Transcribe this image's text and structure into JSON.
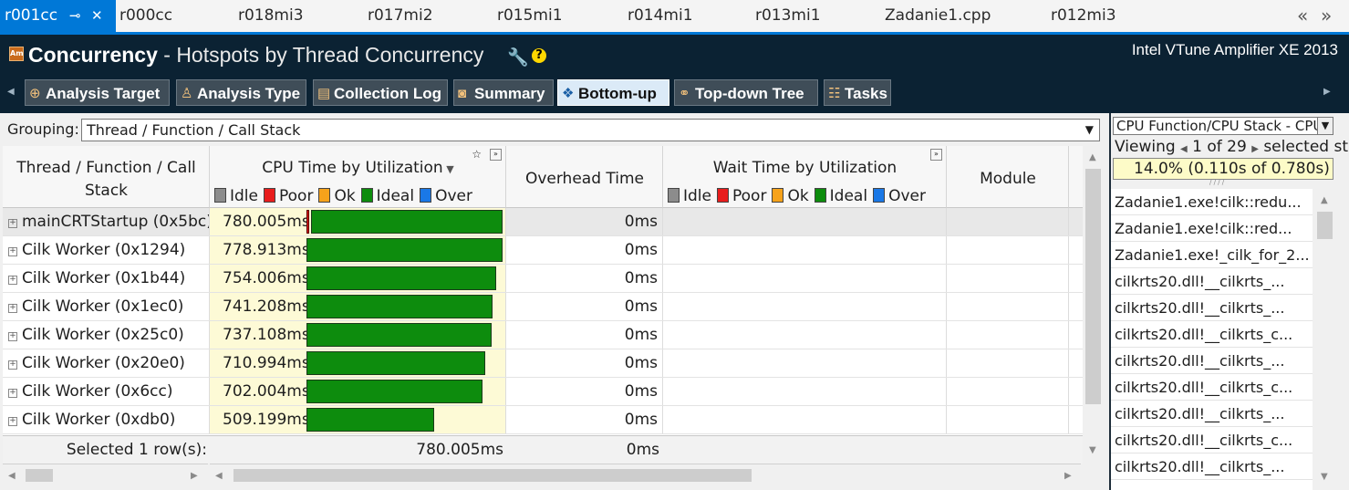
{
  "doc_tabs": [
    {
      "label": "r001cc",
      "active": true
    },
    {
      "label": "r000cc"
    },
    {
      "label": "r018mi3"
    },
    {
      "label": "r017mi2"
    },
    {
      "label": "r015mi1"
    },
    {
      "label": "r014mi1"
    },
    {
      "label": "r013mi1"
    },
    {
      "label": "Zadanie1.cpp"
    },
    {
      "label": "r012mi3"
    }
  ],
  "icons": {
    "pin": "pin-icon",
    "close": "close-icon",
    "scroll_left": "double-chevron-left-icon",
    "scroll_right": "double-chevron-right-icon",
    "wrench": "wrench-icon",
    "help": "help-icon"
  },
  "header": {
    "title_bold": "Concurrency",
    "title_rest": " - Hotspots by Thread Concurrency",
    "app_glyph": "Am",
    "product": "Intel VTune Amplifier XE 2013"
  },
  "view_tabs": [
    {
      "label": "Analysis Target",
      "icon": "target-icon",
      "glyph": "⊕"
    },
    {
      "label": "Analysis Type",
      "icon": "analysis-type-icon",
      "glyph": "♙"
    },
    {
      "label": "Collection Log",
      "icon": "log-icon",
      "glyph": "▤"
    },
    {
      "label": "Summary",
      "icon": "summary-icon",
      "glyph": "◙"
    },
    {
      "label": "Bottom-up",
      "icon": "bottom-up-icon",
      "glyph": "❖",
      "active": true
    },
    {
      "label": "Top-down Tree",
      "icon": "tree-icon",
      "glyph": "⚭"
    },
    {
      "label": "Tasks",
      "icon": "tasks-icon",
      "glyph": "☷"
    }
  ],
  "grouping": {
    "label": "Grouping:",
    "value": "Thread / Function / Call Stack"
  },
  "columns": {
    "thread": "Thread / Function / Call Stack",
    "cpu_time": "CPU Time by Utilization",
    "overhead": "Overhead Time",
    "wait_time": "Wait Time by Utilization",
    "module": "Module"
  },
  "legend": [
    {
      "label": "Idle",
      "color": "#8c8c8c"
    },
    {
      "label": "Poor",
      "color": "#e81d1d"
    },
    {
      "label": "Ok",
      "color": "#f6a21b"
    },
    {
      "label": "Ideal",
      "color": "#0d8c0d"
    },
    {
      "label": "Over",
      "color": "#1a78e6"
    }
  ],
  "rows": [
    {
      "name": "mainCRTStartup (0x5bc)",
      "cpu_time": "780.005ms",
      "cpu_ms": 780.005,
      "poor_ms": 15,
      "overhead": "0ms",
      "selected": true
    },
    {
      "name": "Cilk Worker (0x1294)",
      "cpu_time": "778.913ms",
      "cpu_ms": 778.913,
      "poor_ms": 0,
      "overhead": "0ms"
    },
    {
      "name": "Cilk Worker (0x1b44)",
      "cpu_time": "754.006ms",
      "cpu_ms": 754.006,
      "poor_ms": 0,
      "overhead": "0ms"
    },
    {
      "name": "Cilk Worker (0x1ec0)",
      "cpu_time": "741.208ms",
      "cpu_ms": 741.208,
      "poor_ms": 0,
      "overhead": "0ms"
    },
    {
      "name": "Cilk Worker (0x25c0)",
      "cpu_time": "737.108ms",
      "cpu_ms": 737.108,
      "poor_ms": 0,
      "overhead": "0ms"
    },
    {
      "name": "Cilk Worker (0x20e0)",
      "cpu_time": "710.994ms",
      "cpu_ms": 710.994,
      "poor_ms": 0,
      "overhead": "0ms"
    },
    {
      "name": "Cilk Worker (0x6cc)",
      "cpu_time": "702.004ms",
      "cpu_ms": 702.004,
      "poor_ms": 0,
      "overhead": "0ms"
    },
    {
      "name": "Cilk Worker (0xdb0)",
      "cpu_time": "509.199ms",
      "cpu_ms": 509.199,
      "poor_ms": 0,
      "overhead": "0ms"
    }
  ],
  "summary": {
    "label": "Selected 1 row(s):",
    "cpu_time": "780.005ms",
    "overhead": "0ms"
  },
  "stack_pane": {
    "select_value": "CPU Function/CPU Stack - CPU",
    "viewing_label": "Viewing",
    "viewing_pos": "1 of 29",
    "viewing_tail": "selected st",
    "percent": "14.0% (0.110s of 0.780s)",
    "items": [
      "Zadanie1.exe!cilk::redu...",
      "Zadanie1.exe!cilk::red...",
      "Zadanie1.exe!_cilk_for_2...",
      "cilkrts20.dll!__cilkrts_...",
      "cilkrts20.dll!__cilkrts_...",
      "cilkrts20.dll!__cilkrts_c...",
      "cilkrts20.dll!__cilkrts_...",
      "cilkrts20.dll!__cilkrts_c...",
      "cilkrts20.dll!__cilkrts_...",
      "cilkrts20.dll!__cilkrts_c...",
      "cilkrts20.dll!__cilkrts_..."
    ]
  }
}
